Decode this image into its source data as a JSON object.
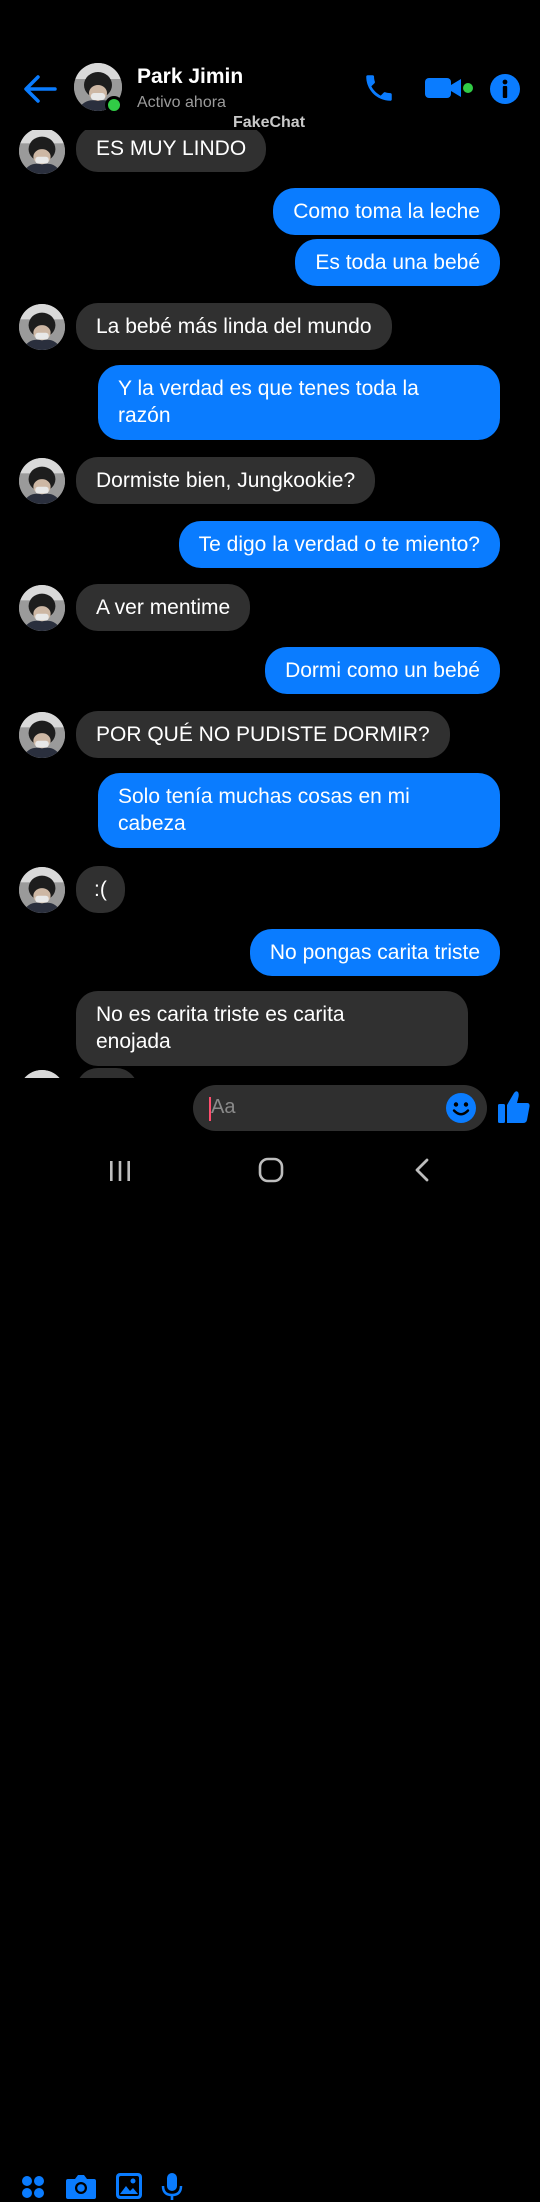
{
  "header": {
    "contact_name": "Park Jimin",
    "status": "Activo ahora",
    "watermark": "FakeChat"
  },
  "colors": {
    "accent": "#0a7cff",
    "incoming_bubble": "#303030",
    "online": "#31cc46",
    "background": "#000000"
  },
  "icons": {
    "back": "arrow-left-icon",
    "call": "phone-icon",
    "video": "video-camera-icon",
    "info": "info-icon",
    "apps": "four-dots-icon",
    "camera": "camera-icon",
    "gallery": "image-icon",
    "mic": "microphone-icon",
    "emoji": "smiley-icon",
    "like": "thumbs-up-icon"
  },
  "messages": [
    {
      "from": "them",
      "text": "ES MUY LINDO"
    },
    {
      "from": "me",
      "text": "Como toma la leche"
    },
    {
      "from": "me",
      "text": "Es toda una bebé"
    },
    {
      "from": "them",
      "text": "La bebé más linda del mundo"
    },
    {
      "from": "me",
      "line1": "Y la verdad es que tenes toda la",
      "line2": "razón"
    },
    {
      "from": "them",
      "text": "Dormiste bien, Jungkookie?"
    },
    {
      "from": "me",
      "text": "Te digo la verdad o te miento?"
    },
    {
      "from": "them",
      "text": "A ver mentime"
    },
    {
      "from": "me",
      "text": "Dormi como un bebé"
    },
    {
      "from": "them",
      "text": "POR QUÉ NO PUDISTE DORMIR?"
    },
    {
      "from": "me",
      "line1": "Solo tenía muchas cosas en mi",
      "line2": "cabeza"
    },
    {
      "from": "them",
      "text": ":("
    },
    {
      "from": "me",
      "text": "No pongas carita triste"
    },
    {
      "from": "them",
      "line1": "No es carita triste es carita",
      "line2": "enojada"
    }
  ],
  "composer": {
    "placeholder": "Aa"
  }
}
